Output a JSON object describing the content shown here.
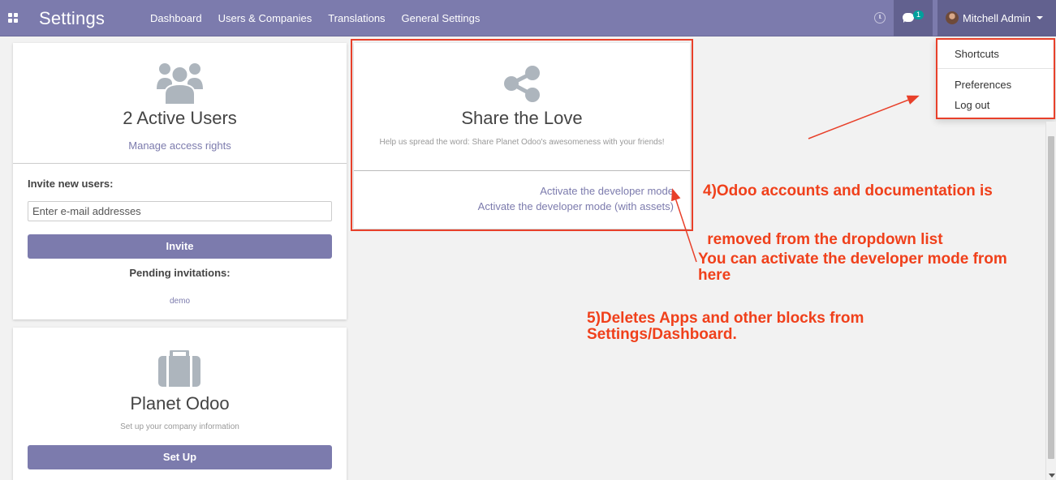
{
  "navbar": {
    "app_title": "Settings",
    "menu": [
      "Dashboard",
      "Users & Companies",
      "Translations",
      "General Settings"
    ],
    "chat_badge": "1",
    "user_name": "Mitchell Admin"
  },
  "user_menu": {
    "items": [
      "Shortcuts",
      "Preferences",
      "Log out"
    ]
  },
  "users_card": {
    "title": "2 Active Users",
    "manage_link": "Manage access rights",
    "invite_label": "Invite new users:",
    "email_placeholder": "Enter e-mail addresses",
    "invite_button": "Invite",
    "pending_label": "Pending invitations:",
    "pending_users": [
      "demo"
    ]
  },
  "company_card": {
    "title": "Planet Odoo",
    "subtitle": "Set up your company information",
    "setup_button": "Set Up"
  },
  "share_card": {
    "title": "Share the Love",
    "subtitle": "Help us spread the word: Share Planet Odoo's awesomeness with your friends!",
    "dev_mode_link": "Activate the developer mode",
    "dev_mode_assets_link": "Activate the developer mode (with assets)"
  },
  "annotations": {
    "note_4": [
      "4)Odoo accounts and documentation is",
      " removed from the dropdown list"
    ],
    "note_dev": [
      "You can activate the developer mode from",
      "here"
    ],
    "note_5": [
      "5)Deletes Apps and other blocks from",
      "Settings/Dashboard."
    ],
    "color": "#f0401b"
  },
  "colors": {
    "brand": "#7c7bad",
    "navbar_active": "#62618f",
    "badge": "#00a09d",
    "highlight_border": "#e8402a"
  }
}
